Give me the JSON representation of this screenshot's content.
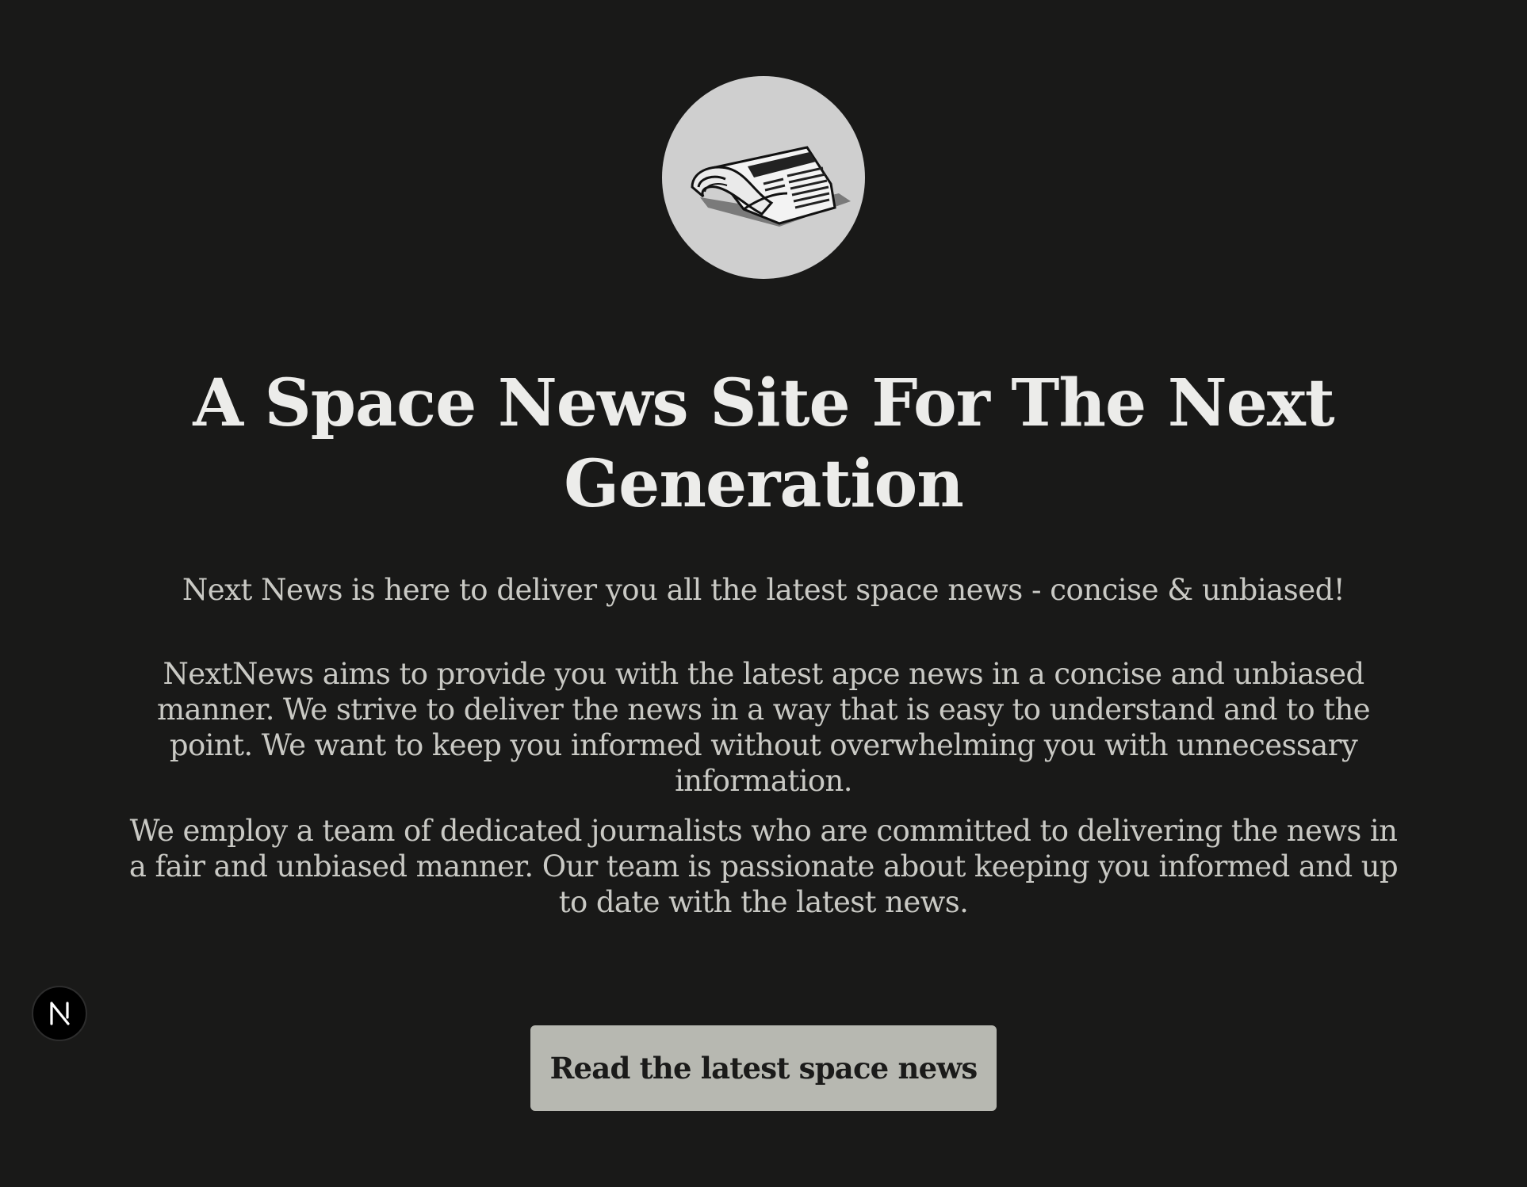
{
  "hero": {
    "logo_icon": "newspaper-icon",
    "headline": "A Space News Site For The Next Generation",
    "tagline": "Next News is here to deliver you all the latest space news - concise & unbiased!",
    "about": "NextNews aims to provide you with the latest apce news in a concise and unbiased manner. We strive to deliver the news in a way that is easy to understand and to the point. We want to keep you informed without overwhelming you with unnecessary information.",
    "team": "We employ a team of dedicated journalists who are committed to delivering the news in a fair and unbiased manner. Our team is passionate about keeping you informed and up to date with the latest news.",
    "cta_label": "Read the latest space news"
  },
  "dev_badge": {
    "icon": "nextjs-logo-icon",
    "letter": "N"
  },
  "colors": {
    "background": "#191918",
    "logo_circle": "#cfcfcf",
    "headline": "#ececea",
    "body_text": "#c9c9c4",
    "button_bg": "#b7b8b1",
    "button_text": "#1b1b1a"
  }
}
